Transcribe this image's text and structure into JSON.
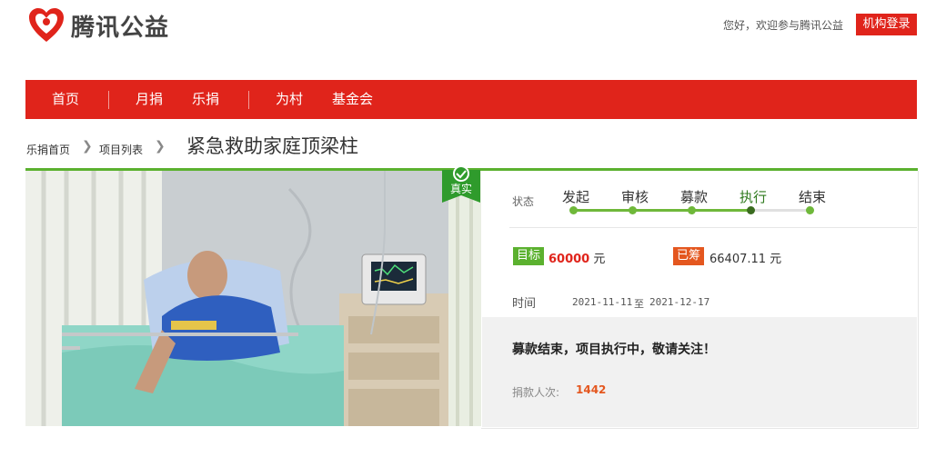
{
  "brand": {
    "name": "腾讯公益",
    "color": "#e0241b"
  },
  "header": {
    "welcome": "您好，欢迎参与腾讯公益",
    "login": "机构登录"
  },
  "nav": [
    "首页",
    "月捐",
    "乐捐",
    "为村",
    "基金会"
  ],
  "breadcrumb": {
    "items": [
      "乐捐首页",
      "项目列表"
    ],
    "title": "紧急救助家庭顶梁柱"
  },
  "badge": "真实",
  "status": {
    "label": "状态",
    "steps": [
      "发起",
      "审核",
      "募款",
      "执行",
      "结束"
    ],
    "current_step": "执行"
  },
  "goal": {
    "tag": "目标",
    "amount": "60000",
    "unit": "元"
  },
  "raised": {
    "tag": "已筹",
    "amount": "66407.11",
    "unit": "元"
  },
  "time": {
    "label": "时间",
    "start": "2021-11-11",
    "sep": "至",
    "end": "2021-12-17"
  },
  "notice": "募款结束，项目执行中，敬请关注！",
  "donors": {
    "label": "捐款人次:",
    "count": "1442"
  },
  "colors": {
    "green": "#5bb12f",
    "orange": "#e4571f"
  }
}
